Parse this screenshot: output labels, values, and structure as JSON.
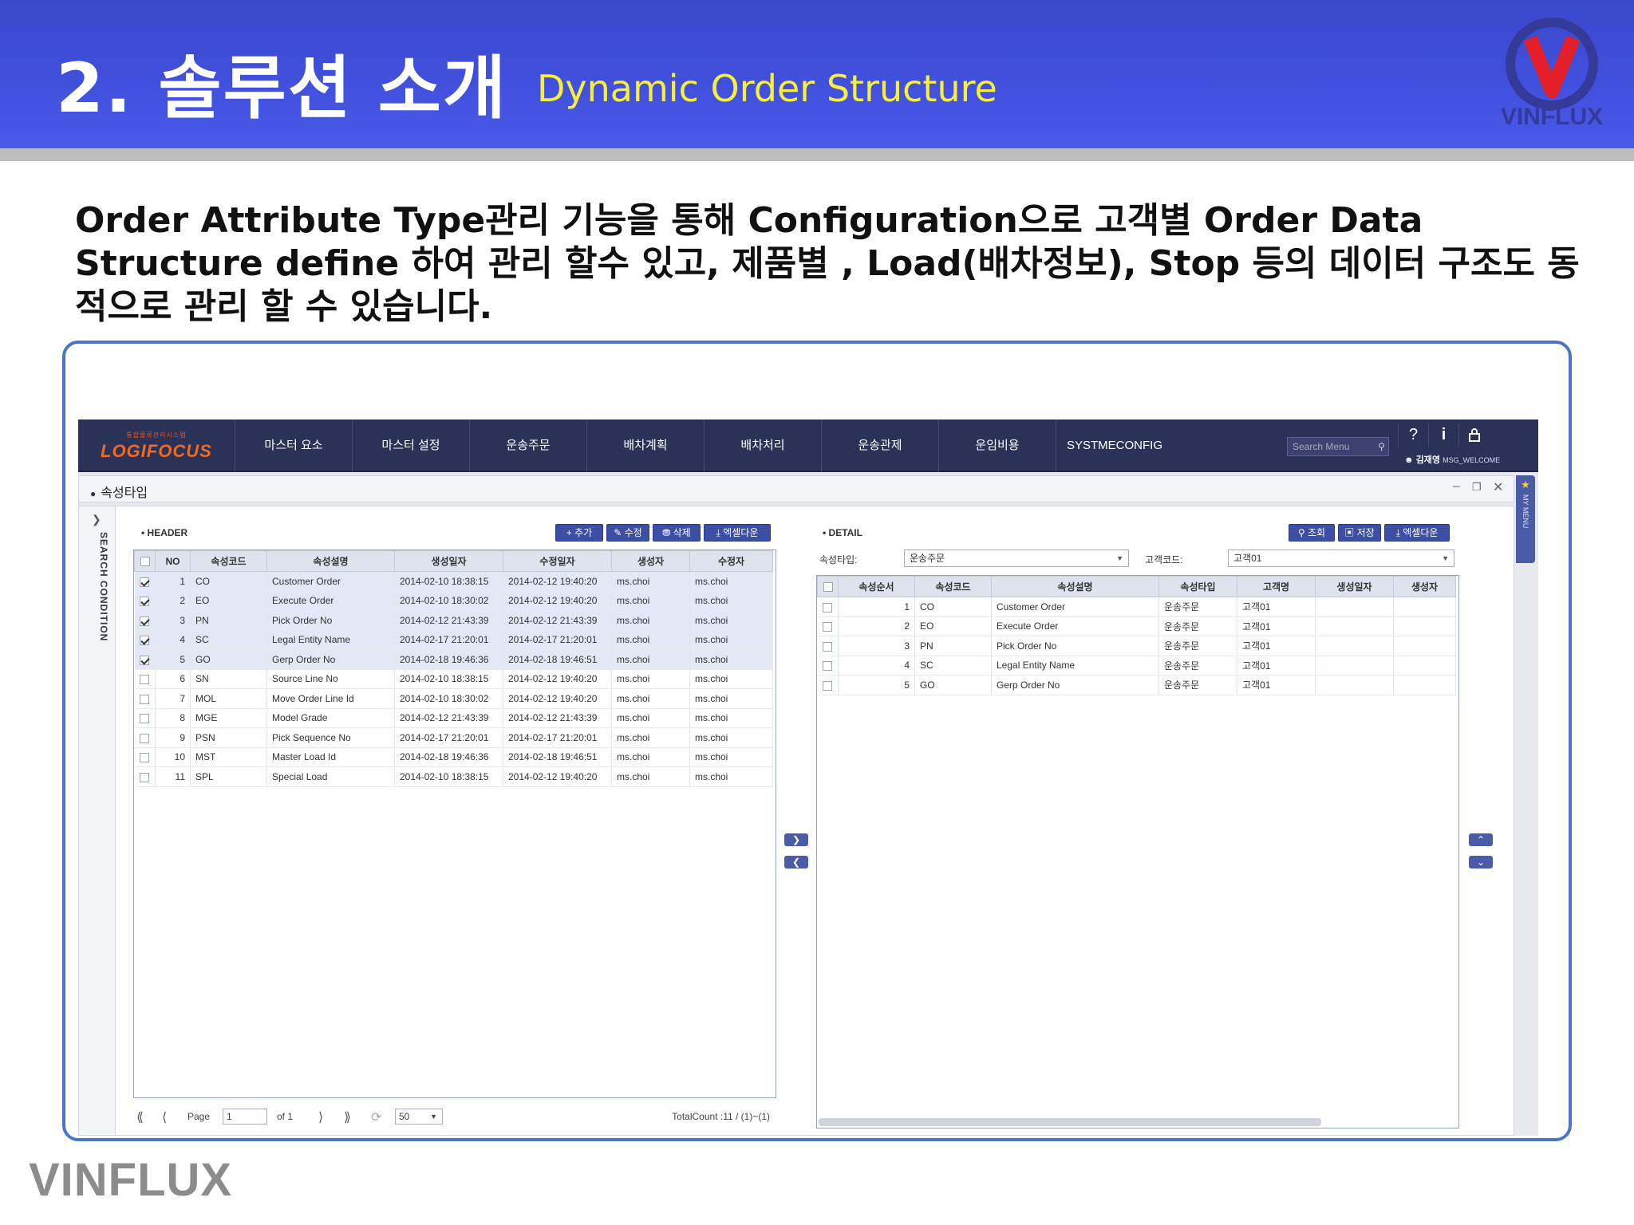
{
  "slide": {
    "title": "2. 솔루션 소개",
    "subtitle": "Dynamic Order Structure",
    "logo_text": "VINFLUX",
    "description": "Order Attribute Type관리 기능을 통해 Configuration으로 고객별 Order Data Structure define 하여 관리 할수 있고, 제품별 , Load(배차정보), Stop 등의 데이터 구조도 동적으로 관리 할 수 있습니다.",
    "footer_brand": "VINFLUX",
    "colors": {
      "header_blue": "#4150dc",
      "subtitle_yellow": "#f7ef3a",
      "frame_blue": "#4a75c8",
      "nav_dark": "#2b3258"
    }
  },
  "app": {
    "logo_sub": "통합물류관리시스템",
    "logo_main": "LOGIFOCUS",
    "nav": [
      "마스터 요소",
      "마스터 설정",
      "운송주문",
      "배차계획",
      "배차처리",
      "운송관제",
      "운임비용",
      "SYSTMECONFIG"
    ],
    "search_placeholder": "Search Menu",
    "icons": {
      "help": "?",
      "info": "i",
      "lock": "lock-icon"
    },
    "user_name": "김재영",
    "user_msg": "MSG_WELCOME",
    "page_title": "속성타입",
    "side_label": "SEARCH CONDITION",
    "my_menu": "MY MENU"
  },
  "header_panel": {
    "label": "• HEADER",
    "buttons": [
      "+ 추가",
      "수정",
      "삭제",
      "엑셀다운"
    ],
    "columns": [
      "NO",
      "속성코드",
      "속성설명",
      "생성일자",
      "수정일자",
      "생성자",
      "수정자"
    ],
    "rows": [
      {
        "checked": true,
        "no": "1",
        "code": "CO",
        "desc": "Customer Order",
        "created": "2014-02-10 18:38:15",
        "modified": "2014-02-12 19:40:20",
        "creator": "ms.choi",
        "modifier": "ms.choi"
      },
      {
        "checked": true,
        "no": "2",
        "code": "EO",
        "desc": "Execute Order",
        "created": "2014-02-10 18:30:02",
        "modified": "2014-02-12 19:40:20",
        "creator": "ms.choi",
        "modifier": "ms.choi"
      },
      {
        "checked": true,
        "no": "3",
        "code": "PN",
        "desc": "Pick Order No",
        "created": "2014-02-12 21:43:39",
        "modified": "2014-02-12 21:43:39",
        "creator": "ms.choi",
        "modifier": "ms.choi"
      },
      {
        "checked": true,
        "no": "4",
        "code": "SC",
        "desc": "Legal Entity Name",
        "created": "2014-02-17 21:20:01",
        "modified": "2014-02-17 21:20:01",
        "creator": "ms.choi",
        "modifier": "ms.choi"
      },
      {
        "checked": true,
        "no": "5",
        "code": "GO",
        "desc": "Gerp Order No",
        "created": "2014-02-18 19:46:36",
        "modified": "2014-02-18 19:46:51",
        "creator": "ms.choi",
        "modifier": "ms.choi"
      },
      {
        "checked": false,
        "no": "6",
        "code": "SN",
        "desc": "Source Line No",
        "created": "2014-02-10 18:38:15",
        "modified": "2014-02-12 19:40:20",
        "creator": "ms.choi",
        "modifier": "ms.choi"
      },
      {
        "checked": false,
        "no": "7",
        "code": "MOL",
        "desc": "Move Order Line Id",
        "created": "2014-02-10 18:30:02",
        "modified": "2014-02-12 19:40:20",
        "creator": "ms.choi",
        "modifier": "ms.choi"
      },
      {
        "checked": false,
        "no": "8",
        "code": "MGE",
        "desc": "Model Grade",
        "created": "2014-02-12 21:43:39",
        "modified": "2014-02-12 21:43:39",
        "creator": "ms.choi",
        "modifier": "ms.choi"
      },
      {
        "checked": false,
        "no": "9",
        "code": "PSN",
        "desc": "Pick Sequence No",
        "created": "2014-02-17 21:20:01",
        "modified": "2014-02-17 21:20:01",
        "creator": "ms.choi",
        "modifier": "ms.choi"
      },
      {
        "checked": false,
        "no": "10",
        "code": "MST",
        "desc": "Master Load Id",
        "created": "2014-02-18 19:46:36",
        "modified": "2014-02-18 19:46:51",
        "creator": "ms.choi",
        "modifier": "ms.choi"
      },
      {
        "checked": false,
        "no": "11",
        "code": "SPL",
        "desc": "Special Load",
        "created": "2014-02-10 18:38:15",
        "modified": "2014-02-12 19:40:20",
        "creator": "ms.choi",
        "modifier": "ms.choi"
      }
    ],
    "pager": {
      "page_label": "Page",
      "page": "1",
      "of": "of 1",
      "size": "50",
      "total": "TotalCount :11 / (1)~(1)"
    }
  },
  "detail_panel": {
    "label": "• DETAIL",
    "buttons": [
      "조회",
      "저장",
      "엑셀다운"
    ],
    "filter_type_label": "속성타입:",
    "filter_type_value": "운송주문",
    "filter_cust_label": "고객코드:",
    "filter_cust_value": "고객01",
    "columns": [
      "속성순서",
      "속성코드",
      "속성설명",
      "속성타입",
      "고객명",
      "생성일자",
      "생성자"
    ],
    "rows": [
      {
        "seq": "1",
        "code": "CO",
        "desc": "Customer Order",
        "type": "운송주문",
        "customer": "고객01"
      },
      {
        "seq": "2",
        "code": "EO",
        "desc": "Execute Order",
        "type": "운송주문",
        "customer": "고객01"
      },
      {
        "seq": "3",
        "code": "PN",
        "desc": "Pick Order No",
        "type": "운송주문",
        "customer": "고객01"
      },
      {
        "seq": "4",
        "code": "SC",
        "desc": "Legal Entity Name",
        "type": "운송주문",
        "customer": "고객01"
      },
      {
        "seq": "5",
        "code": "GO",
        "desc": "Gerp Order No",
        "type": "운송주문",
        "customer": "고객01"
      }
    ]
  }
}
